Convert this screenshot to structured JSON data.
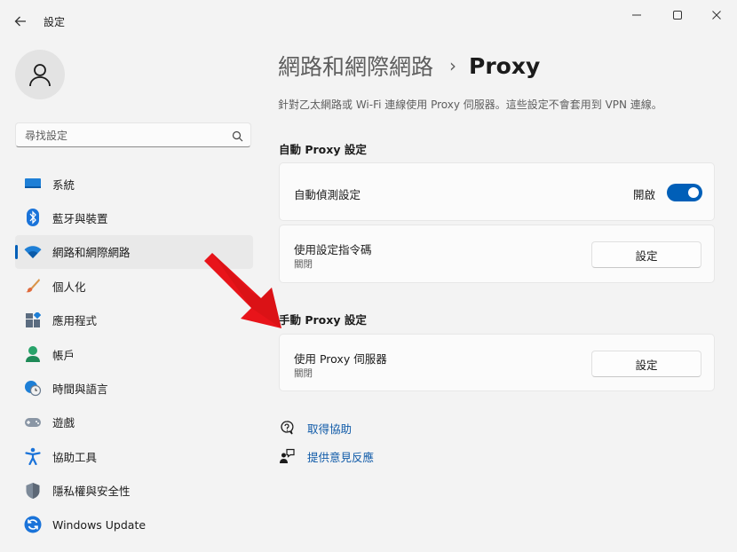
{
  "window": {
    "title": "設定"
  },
  "user": {
    "avatar_icon": "person-icon"
  },
  "search": {
    "placeholder": "尋找設定"
  },
  "sidebar": {
    "active_index": 2,
    "items": [
      {
        "label": "系統",
        "icon": "display-icon"
      },
      {
        "label": "藍牙與裝置",
        "icon": "bluetooth-icon"
      },
      {
        "label": "網路和網際網路",
        "icon": "wifi-icon"
      },
      {
        "label": "個人化",
        "icon": "brush-icon"
      },
      {
        "label": "應用程式",
        "icon": "apps-icon"
      },
      {
        "label": "帳戶",
        "icon": "account-icon"
      },
      {
        "label": "時間與語言",
        "icon": "clock-globe-icon"
      },
      {
        "label": "遊戲",
        "icon": "gamepad-icon"
      },
      {
        "label": "協助工具",
        "icon": "accessibility-icon"
      },
      {
        "label": "隱私權與安全性",
        "icon": "shield-icon"
      },
      {
        "label": "Windows Update",
        "icon": "update-icon"
      }
    ]
  },
  "main": {
    "breadcrumb_parent": "網路和網際網路",
    "breadcrumb_separator": "›",
    "breadcrumb_current": "Proxy",
    "description": "針對乙太網路或 Wi-Fi 連線使用 Proxy 伺服器。這些設定不會套用到 VPN 連線。",
    "auto_section": {
      "title": "自動 Proxy 設定",
      "detect": {
        "label": "自動偵測設定",
        "state_label": "開啟",
        "on": true
      },
      "script": {
        "label": "使用設定指令碼",
        "status": "關閉",
        "button": "設定"
      }
    },
    "manual_section": {
      "title": "手動 Proxy 設定",
      "proxy_server": {
        "label": "使用 Proxy 伺服器",
        "status": "關閉",
        "button": "設定"
      }
    },
    "links": {
      "help": "取得協助",
      "feedback": "提供意見反應"
    }
  },
  "colors": {
    "accent": "#005fb8",
    "annotation_arrow": "#e8141a"
  }
}
